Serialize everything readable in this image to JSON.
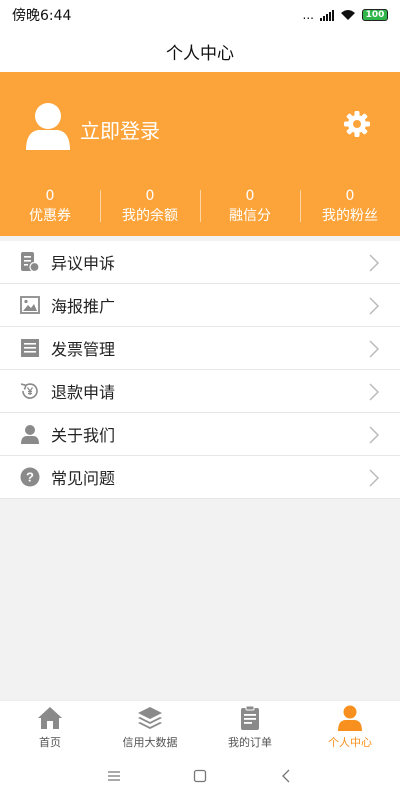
{
  "status_bar": {
    "time": "傍晚6:44",
    "network": "...",
    "battery": "100"
  },
  "title": "个人中心",
  "header": {
    "login_label": "立即登录",
    "stats": [
      {
        "value": "0",
        "label": "优惠券"
      },
      {
        "value": "0",
        "label": "我的余额"
      },
      {
        "value": "0",
        "label": "融信分"
      },
      {
        "value": "0",
        "label": "我的粉丝"
      }
    ]
  },
  "menu": [
    {
      "label": "异议申诉",
      "icon": "dispute-icon"
    },
    {
      "label": "海报推广",
      "icon": "poster-image-icon"
    },
    {
      "label": "发票管理",
      "icon": "invoice-icon"
    },
    {
      "label": "退款申请",
      "icon": "refund-icon"
    },
    {
      "label": "关于我们",
      "icon": "about-user-icon"
    },
    {
      "label": "常见问题",
      "icon": "question-icon"
    }
  ],
  "tabbar": [
    {
      "label": "首页",
      "icon": "home-icon",
      "active": false
    },
    {
      "label": "信用大数据",
      "icon": "layers-icon",
      "active": false
    },
    {
      "label": "我的订单",
      "icon": "clipboard-icon",
      "active": false
    },
    {
      "label": "个人中心",
      "icon": "person-icon",
      "active": true
    }
  ],
  "colors": {
    "accent": "#fca43a",
    "tab_active": "#f7901e",
    "icon_gray": "#8a8a8a"
  }
}
